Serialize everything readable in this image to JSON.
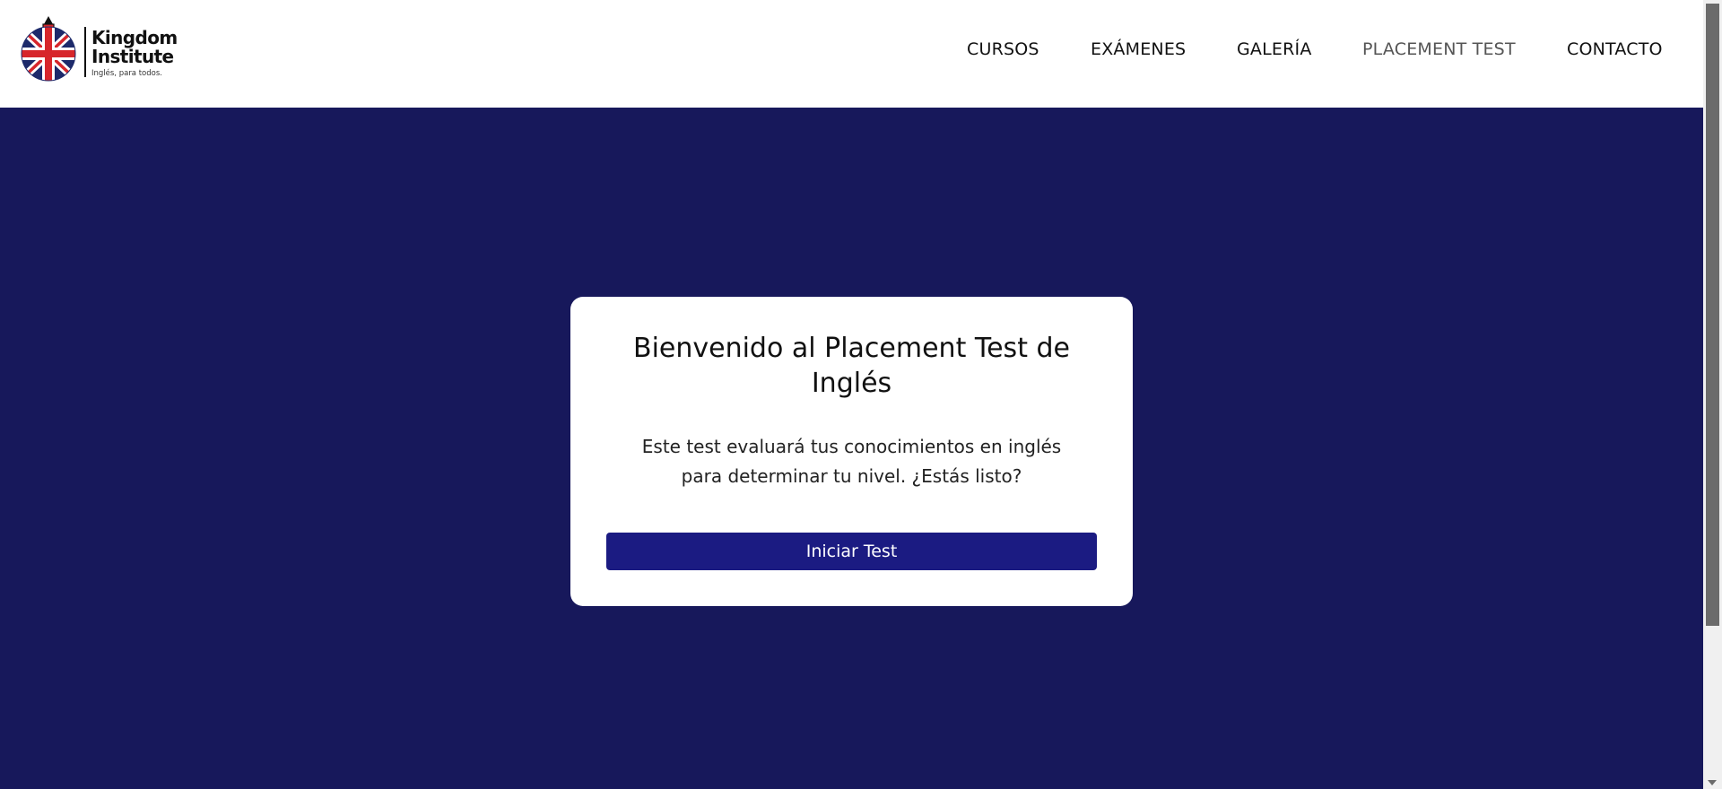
{
  "header": {
    "logo": {
      "name_line1": "Kingdom",
      "name_line2": "Institute",
      "tagline": "Inglés, para todos."
    },
    "nav": [
      "CURSOS",
      "EXÁMENES",
      "GALERÍA",
      "PLACEMENT TEST",
      "CONTACTO"
    ],
    "active_nav": "PLACEMENT TEST"
  },
  "card": {
    "title": "Bienvenido al Placement Test de Inglés",
    "description": "Este test evaluará tus conocimientos en inglés para determinar tu nivel. ¿Estás listo?",
    "button_label": "Iniciar Test"
  },
  "colors": {
    "background": "#17185b",
    "button": "#1b1b82",
    "flag_red": "#d7262b",
    "flag_blue": "#1d2a6b"
  }
}
